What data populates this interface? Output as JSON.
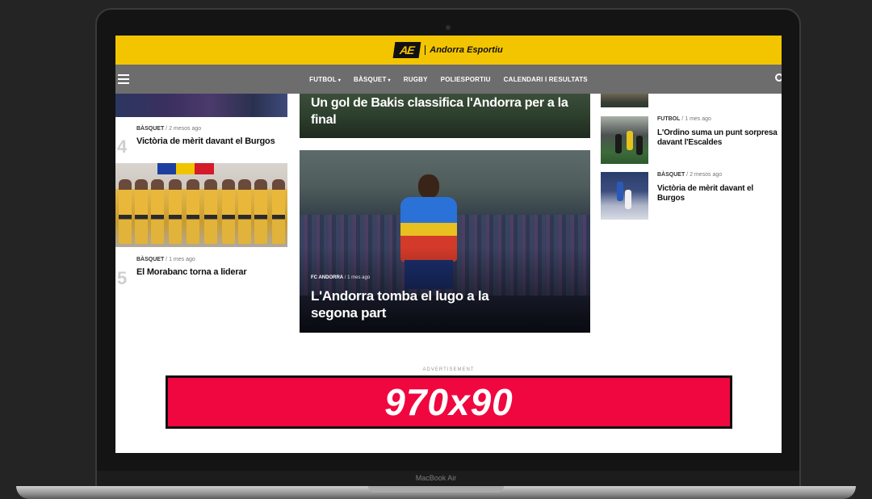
{
  "site": {
    "logo_mark": "AE",
    "name": "Andorra Esportiu"
  },
  "nav": {
    "items": [
      {
        "label": "FUTBOL",
        "caret": true
      },
      {
        "label": "BÀSQUET",
        "caret": true
      },
      {
        "label": "RUGBY",
        "caret": false
      },
      {
        "label": "POLIESPORTIU",
        "caret": false
      },
      {
        "label": "CALENDARI I RESULTATS",
        "caret": false
      }
    ]
  },
  "left_list": [
    {
      "num": "4",
      "category": "BÀSQUET",
      "time": "2 mesos ago",
      "title": "Victòria de mèrit davant el Burgos"
    },
    {
      "num": "5",
      "category": "BÀSQUET",
      "time": "1 mes ago",
      "title": "El Morabanc torna a liderar"
    }
  ],
  "center": {
    "top_title": "Un gol de Bakis classifica l'Andorra per a la final",
    "main": {
      "category": "FC ANDORRA",
      "time": "1 mes ago",
      "title": "L'Andorra tomba el lugo a la segona part"
    }
  },
  "right_list": [
    {
      "category": "FUTBOL",
      "time": "1 mes ago",
      "title": "L'Ordino suma un punt sorpresa davant l'Escaldes"
    },
    {
      "category": "BÀSQUET",
      "time": "2 mesos ago",
      "title": "Victòria de mèrit davant el Burgos"
    }
  ],
  "ad": {
    "label": "ADVERTISEMENT",
    "text": "970x90"
  },
  "device": {
    "label": "MacBook Air"
  },
  "colors": {
    "brand_yellow": "#f3c500",
    "nav_gray": "#6d6d6d",
    "ad_red": "#f0073f"
  },
  "icons": {
    "menu": "hamburger-icon",
    "search": "search-icon"
  }
}
